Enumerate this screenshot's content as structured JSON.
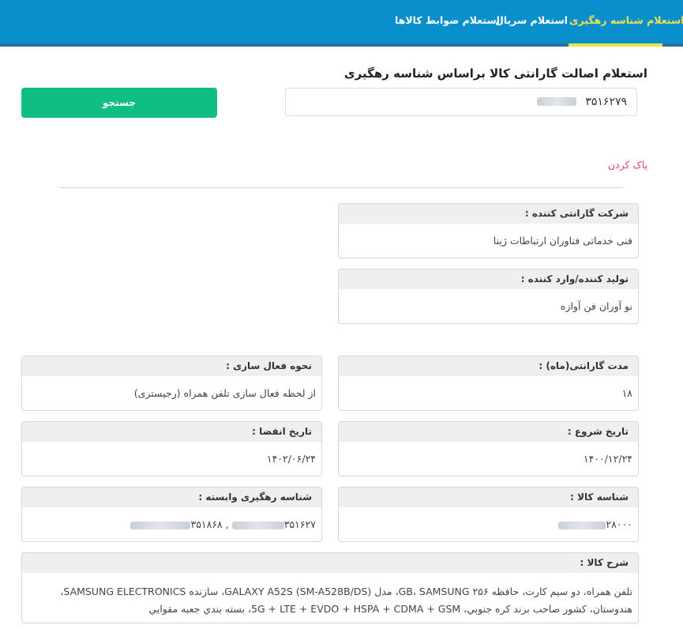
{
  "tabs": [
    {
      "label": "استعلام شناسه رهگیری",
      "active": true
    },
    {
      "label": "استعلام سریال",
      "active": false
    },
    {
      "label": "استعلام ضوابط کالاها",
      "active": false
    }
  ],
  "page_title": "استعلام اصالت گارانتی کالا براساس شناسه رهگیری",
  "search": {
    "value_visible": "۳۵۱۶۲۷۹",
    "button_label": "جستجو"
  },
  "clear_label": "پاک کردن",
  "fields": {
    "warranty_company": {
      "label": "شرکت گارانتی کننده :",
      "value": "فنی خدماتی فناوران ارتباطات ژینا"
    },
    "producer": {
      "label": "تولید کننده/وارد کننده :",
      "value": "نو آوران فن آوازه"
    },
    "warranty_period": {
      "label": "مدت گارانتی(ماه) :",
      "value": "۱۸"
    },
    "activation": {
      "label": "نحوه فعال سازی :",
      "value": "از لحظه فعال سازی تلفن همراه (رجیستری)"
    },
    "start_date": {
      "label": "تاریخ شروع :",
      "value": "۱۴۰۰/۱۲/۲۴"
    },
    "expiry_date": {
      "label": "تاریخ انقضا :",
      "value": "۱۴۰۲/۰۶/۲۴"
    },
    "product_id": {
      "label": "شناسه کالا :",
      "value_visible": "۲۸۰۰۰"
    },
    "linked_tracking": {
      "label": "شناسه رهگیری وابسته :",
      "value_a": "۳۵۱۸۶۸",
      "separator": " , ",
      "value_b": "۳۵۱۶۲۷"
    },
    "description": {
      "label": "شرح کالا :",
      "line1": "تلفن همراه، دو سیم کارت، حافظه ۲۵۶ GB، SAMSUNG، مدل GALAXY A52S (SM-A528B/DS)، سازنده SAMSUNG ELECTRONICS،",
      "line2": "هندوستان، کشور صاحب برند کره جنوبي، 5G + LTE + EVDO + HSPA + CDMA + GSM، بسته بندي جعبه مقوايي"
    }
  },
  "colors": {
    "header": "#0a8fcd",
    "active_tab": "#f2e04a",
    "search_button": "#10bd84",
    "clear_link": "#e4436e"
  }
}
